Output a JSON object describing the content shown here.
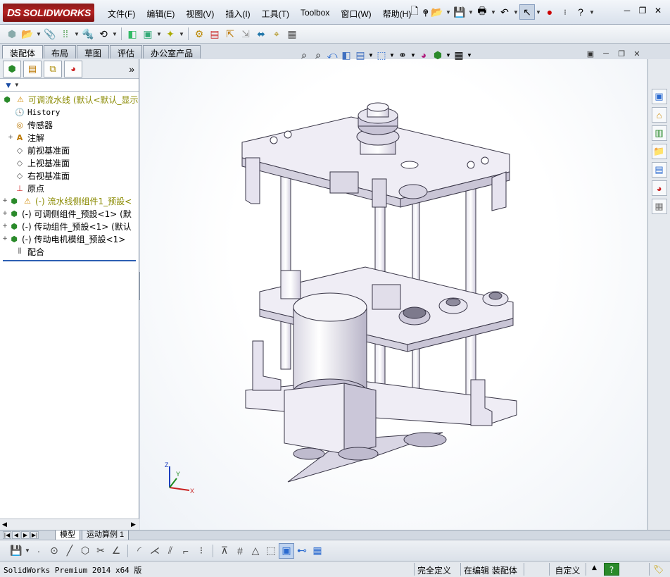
{
  "app": {
    "logo_text": "SOLIDWORKS",
    "logo_mark": "DS"
  },
  "menu": [
    "文件(F)",
    "编辑(E)",
    "视图(V)",
    "插入(I)",
    "工具(T)",
    "Toolbox",
    "窗口(W)",
    "帮助(H)"
  ],
  "command_tabs": [
    {
      "label": "装配体",
      "active": true
    },
    {
      "label": "布局",
      "active": false
    },
    {
      "label": "草图",
      "active": false
    },
    {
      "label": "评估",
      "active": false
    },
    {
      "label": "办公室产品",
      "active": false
    }
  ],
  "feature_tree": {
    "filter_icon": "filter-icon",
    "rows": [
      {
        "expander": "",
        "icon": "assembly-icon",
        "warn": true,
        "label": "可调流水线  (默认<默认_显示",
        "style": "olive",
        "indent": 0
      },
      {
        "expander": "",
        "icon": "history-icon",
        "warn": false,
        "label": "History",
        "style": "normal",
        "indent": 1
      },
      {
        "expander": "",
        "icon": "sensor-icon",
        "warn": false,
        "label": "传感器",
        "style": "normal",
        "indent": 1
      },
      {
        "expander": "+",
        "icon": "annotation-icon",
        "warn": false,
        "label": "注解",
        "style": "normal",
        "indent": 1
      },
      {
        "expander": "",
        "icon": "plane-icon",
        "warn": false,
        "label": "前视基准面",
        "style": "normal",
        "indent": 1
      },
      {
        "expander": "",
        "icon": "plane-icon",
        "warn": false,
        "label": "上视基准面",
        "style": "normal",
        "indent": 1
      },
      {
        "expander": "",
        "icon": "plane-icon",
        "warn": false,
        "label": "右视基准面",
        "style": "normal",
        "indent": 1
      },
      {
        "expander": "",
        "icon": "origin-icon",
        "warn": false,
        "label": "原点",
        "style": "normal",
        "indent": 1
      },
      {
        "expander": "+",
        "icon": "subassembly-icon",
        "warn": true,
        "label": "(-) 流水线侧组件1_预設<",
        "style": "olive",
        "indent": 1
      },
      {
        "expander": "+",
        "icon": "subassembly-icon",
        "warn": false,
        "label": "(-) 可调侧组件_预設<1> (默",
        "style": "normal",
        "indent": 1
      },
      {
        "expander": "+",
        "icon": "subassembly-icon",
        "warn": false,
        "label": "(-) 传动组件_预設<1> (默认",
        "style": "normal",
        "indent": 1
      },
      {
        "expander": "+",
        "icon": "subassembly-icon",
        "warn": false,
        "label": "(-) 传动电机模组_预設<1>",
        "style": "normal",
        "indent": 1
      },
      {
        "expander": "",
        "icon": "mates-icon",
        "warn": false,
        "label": "配合",
        "style": "normal",
        "indent": 1
      }
    ]
  },
  "model_tabs": [
    {
      "label": "模型",
      "active": true
    },
    {
      "label": "运动算例 1",
      "active": false
    }
  ],
  "status": {
    "product": "SolidWorks Premium 2014 x64 版",
    "definition": "完全定义",
    "mode": "在编辑 装配体",
    "units": "自定义",
    "units_arrow": "▲",
    "help": "?"
  },
  "triad": {
    "x": "X",
    "y": "Y",
    "z": "Z"
  },
  "colors": {
    "accent": "#2d5fb3",
    "warning": "#d08a00",
    "olive_text": "#8a8a00",
    "logo_red": "#b52222"
  }
}
